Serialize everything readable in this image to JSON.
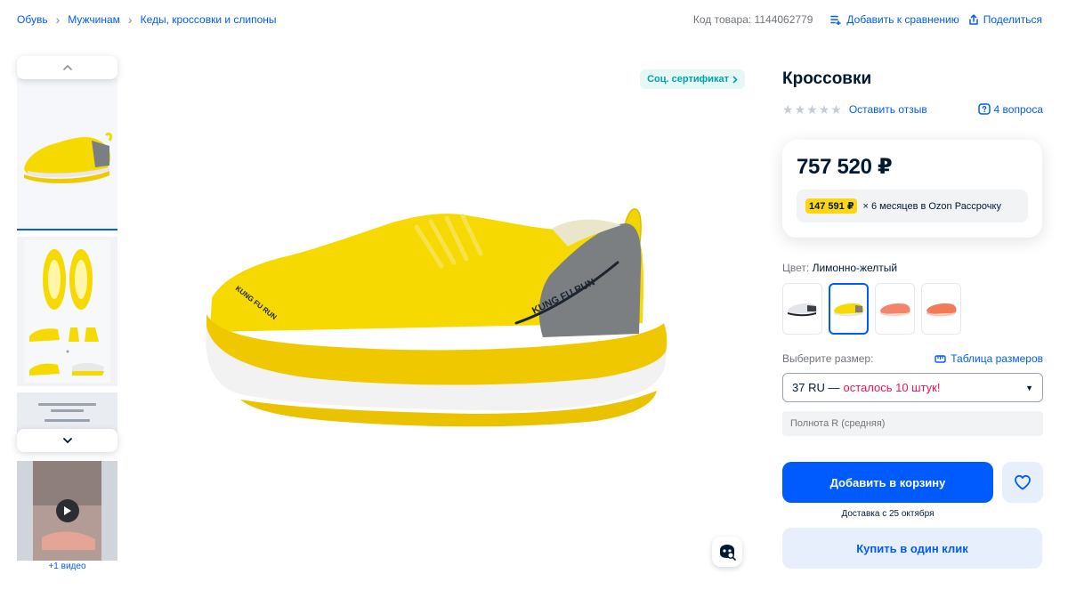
{
  "breadcrumbs": [
    "Обувь",
    "Мужчинам",
    "Кеды, кроссовки и слипоны"
  ],
  "top": {
    "sku": "Код товара: 1144062779",
    "compare": "Добавить к сравнению",
    "share": "Поделиться"
  },
  "thumbs": {
    "doc_title": "Китайские кроссовки для бега Кунг Фу",
    "doc_subtitle": "Анализ технологии",
    "video_caption": "+1 видео"
  },
  "main": {
    "cert_badge": "Соц. сертификат",
    "brand_print": "KUNG FU RUN"
  },
  "product": {
    "title": "Кроссовки",
    "review_link": "Оставить отзыв",
    "questions": "4 вопроса",
    "price": "757 520 ₽",
    "installment_amount": "147 591 ₽",
    "installment_text": "× 6 месяцев в Ozon Рассрочку",
    "color_label": "Цвет:",
    "color_value": "Лимонно-желтый",
    "size_label": "Выберите размер:",
    "size_table": "Таблица размеров",
    "size_selected": "37 RU —",
    "size_warning": "осталось 10 штук!",
    "fullness": "Полнота R (средняя)",
    "cart_button": "Добавить в корзину",
    "delivery": "Доставка с 25 октября",
    "oneclick_button": "Купить в один клик"
  },
  "colors": {
    "accent": "#005bff",
    "shoe_yellow": "#f5d900",
    "warning": "#f91155",
    "installment_badge": "#ffd60a",
    "cert_text": "#00a3a6"
  }
}
